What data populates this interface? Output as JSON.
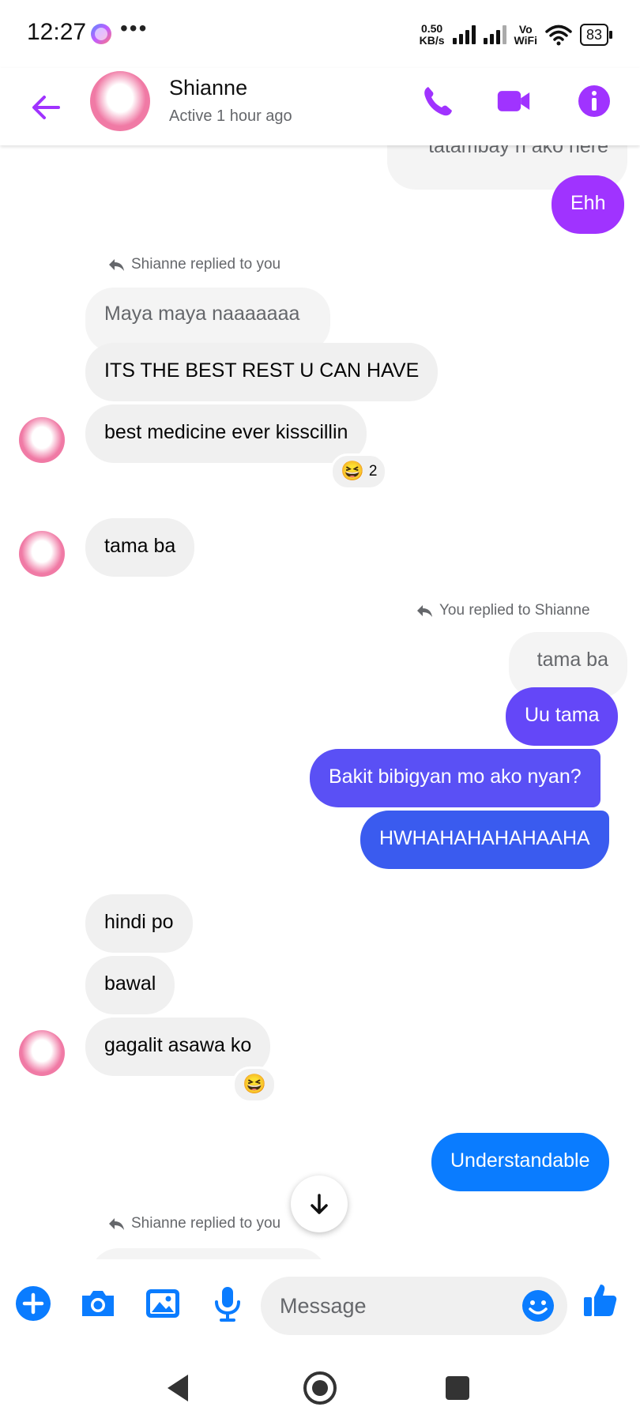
{
  "status_bar": {
    "time": "12:27",
    "more": "•••",
    "net_speed_value": "0.50",
    "net_speed_unit": "KB/s",
    "vowifi_top": "Vo",
    "vowifi_bottom": "WiFi",
    "battery": "83"
  },
  "header": {
    "contact_name": "Shianne",
    "status": "Active 1 hour ago",
    "icons": [
      "back-arrow-icon",
      "phone-icon",
      "video-icon",
      "info-icon"
    ],
    "accent_color": "#a033ff"
  },
  "messages": {
    "top_partial": "tatambay n ako here",
    "ehh": "Ehh",
    "reply_note_1": "Shianne replied to you",
    "quoted_1": "Maya maya naaaaaaa",
    "m_best_rest": "ITS THE BEST REST U CAN HAVE",
    "m_medicine": "best medicine ever kisscillin",
    "reaction_1_emoji": "😆",
    "reaction_1_count": "2",
    "m_tama": "tama ba",
    "reply_note_2": "You replied to Shianne",
    "quoted_2": "tama ba",
    "m_uu": "Uu tama",
    "m_bakit": "Bakit bibigyan mo ako nyan?",
    "m_hwha": "HWHAHAHAHAHAAHA",
    "m_hindi": "hindi po",
    "m_bawal": "bawal",
    "m_gagalit": "gagalit asawa ko",
    "reaction_2_emoji": "😆",
    "m_understandable": "Understandable",
    "reply_note_3": "Shianne replied to you"
  },
  "colors": {
    "purple": "#a033ff",
    "indigo": "#5a50f5",
    "blue": "#3a5bef",
    "messenger_blue": "#0a7cff",
    "incoming_bg": "#f0f0f0"
  },
  "composer": {
    "placeholder": "Message",
    "icons": [
      "add-icon",
      "camera-icon",
      "gallery-icon",
      "mic-icon",
      "emoji-icon",
      "thumbs-up-icon"
    ]
  },
  "navbar": {
    "icons": [
      "nav-back-icon",
      "nav-home-icon",
      "nav-recents-icon"
    ]
  }
}
